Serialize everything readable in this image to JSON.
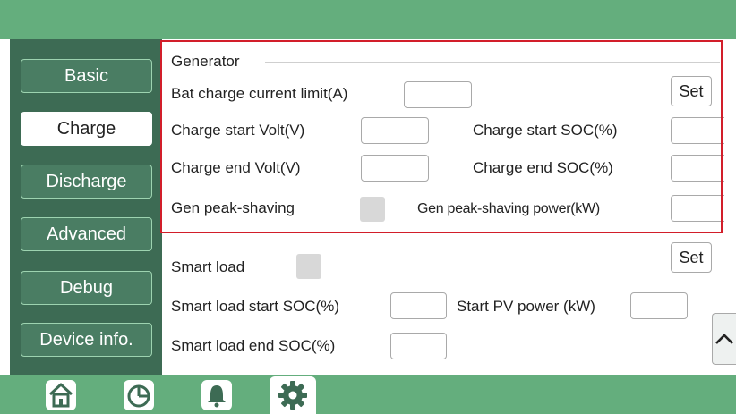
{
  "sidebar": {
    "items": [
      {
        "label": "Basic"
      },
      {
        "label": "Charge"
      },
      {
        "label": "Discharge"
      },
      {
        "label": "Advanced"
      },
      {
        "label": "Debug"
      },
      {
        "label": "Device info."
      }
    ]
  },
  "generator": {
    "title": "Generator",
    "bat_charge_current_limit": "Bat charge current limit(A)",
    "charge_start_volt": "Charge start Volt(V)",
    "charge_start_soc": "Charge start SOC(%)",
    "charge_end_volt": "Charge end Volt(V)",
    "charge_end_soc": "Charge end SOC(%)",
    "gen_peak_shaving": "Gen peak-shaving",
    "gen_peak_shaving_power": "Gen peak-shaving power(kW)",
    "set_label": "Set"
  },
  "smart_load": {
    "smart_load": "Smart load",
    "start_soc": "Smart load start SOC(%)",
    "start_pv_power": "Start PV power (kW)",
    "end_soc": "Smart load end SOC(%)",
    "set_label": "Set"
  },
  "colors": {
    "topbar": "#64ae7d",
    "sidebar": "#3d6b54",
    "highlight_border": "#d21e2a"
  },
  "bottom_nav": [
    "home-icon",
    "chart-icon",
    "bell-icon",
    "gear-icon"
  ]
}
